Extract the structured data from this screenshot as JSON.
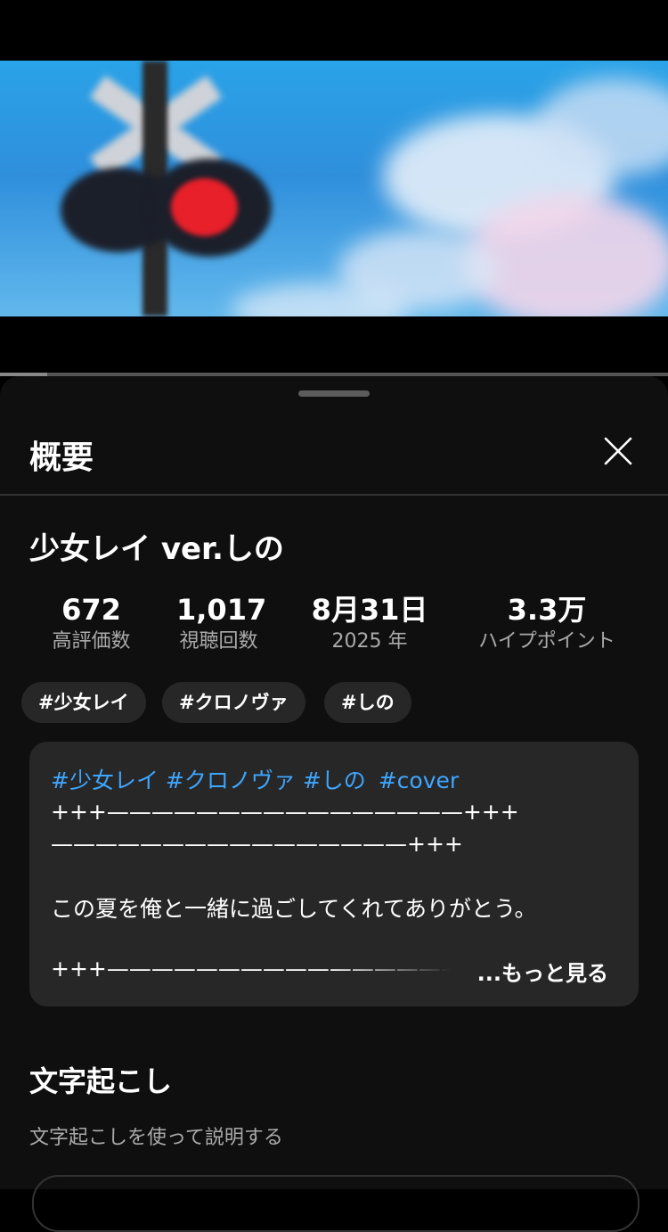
{
  "sheet": {
    "title": "概要",
    "close_icon": "close-icon"
  },
  "video": {
    "title": "少女レイ ver.しの",
    "progress_fraction": 0.07
  },
  "stats": [
    {
      "value": "672",
      "label": "高評価数"
    },
    {
      "value": "1,017",
      "label": "視聴回数"
    },
    {
      "value": "8月31日",
      "label": "2025 年"
    },
    {
      "value": "3.3万",
      "label": "ハイプポイント"
    }
  ],
  "tags": [
    "#少女レイ",
    "#クロノヴァ",
    "#しの"
  ],
  "description": {
    "hashtags": [
      "#少女レイ",
      "#クロノヴァ",
      "#しの",
      "#cover"
    ],
    "line2": "+++————————————————+++",
    "line3": "————————————————+++",
    "line4": "この夏を俺と一緒に過ごしてくれてありがとう。",
    "line5": "+++————————————————+++——",
    "more_label": "...もっと見る"
  },
  "transcript": {
    "title": "文字起こし",
    "subtitle": "文字起こしを使って説明する"
  }
}
